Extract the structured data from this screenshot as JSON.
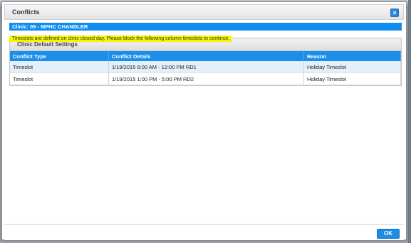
{
  "dialog": {
    "title": "Conflicts",
    "close_glyph": "×"
  },
  "clinic_banner": "Clinic: 09 - MPHC CHANDLER",
  "warning": "Timeslots are defined on clinic closed day. Please block the following column timeslots to continue.",
  "section": {
    "title": "Clinic Default Settings"
  },
  "table": {
    "columns": [
      "Conflict Type",
      "Conflict Details",
      "Reason"
    ],
    "rows": [
      {
        "type": "Timeslot",
        "details": "1/19/2015 8:00 AM - 12:00 PM RD1",
        "reason": "Holiday Timeslot"
      },
      {
        "type": "Timeslot",
        "details": "1/19/2015 1:00 PM - 5:00 PM RD2",
        "reason": "Holiday Timeslot"
      }
    ]
  },
  "footer": {
    "ok_label": "OK"
  },
  "colors": {
    "accent": "#1a8ee8",
    "warning_highlight": "#f5f500",
    "alt_row": "#e3f0fb"
  }
}
